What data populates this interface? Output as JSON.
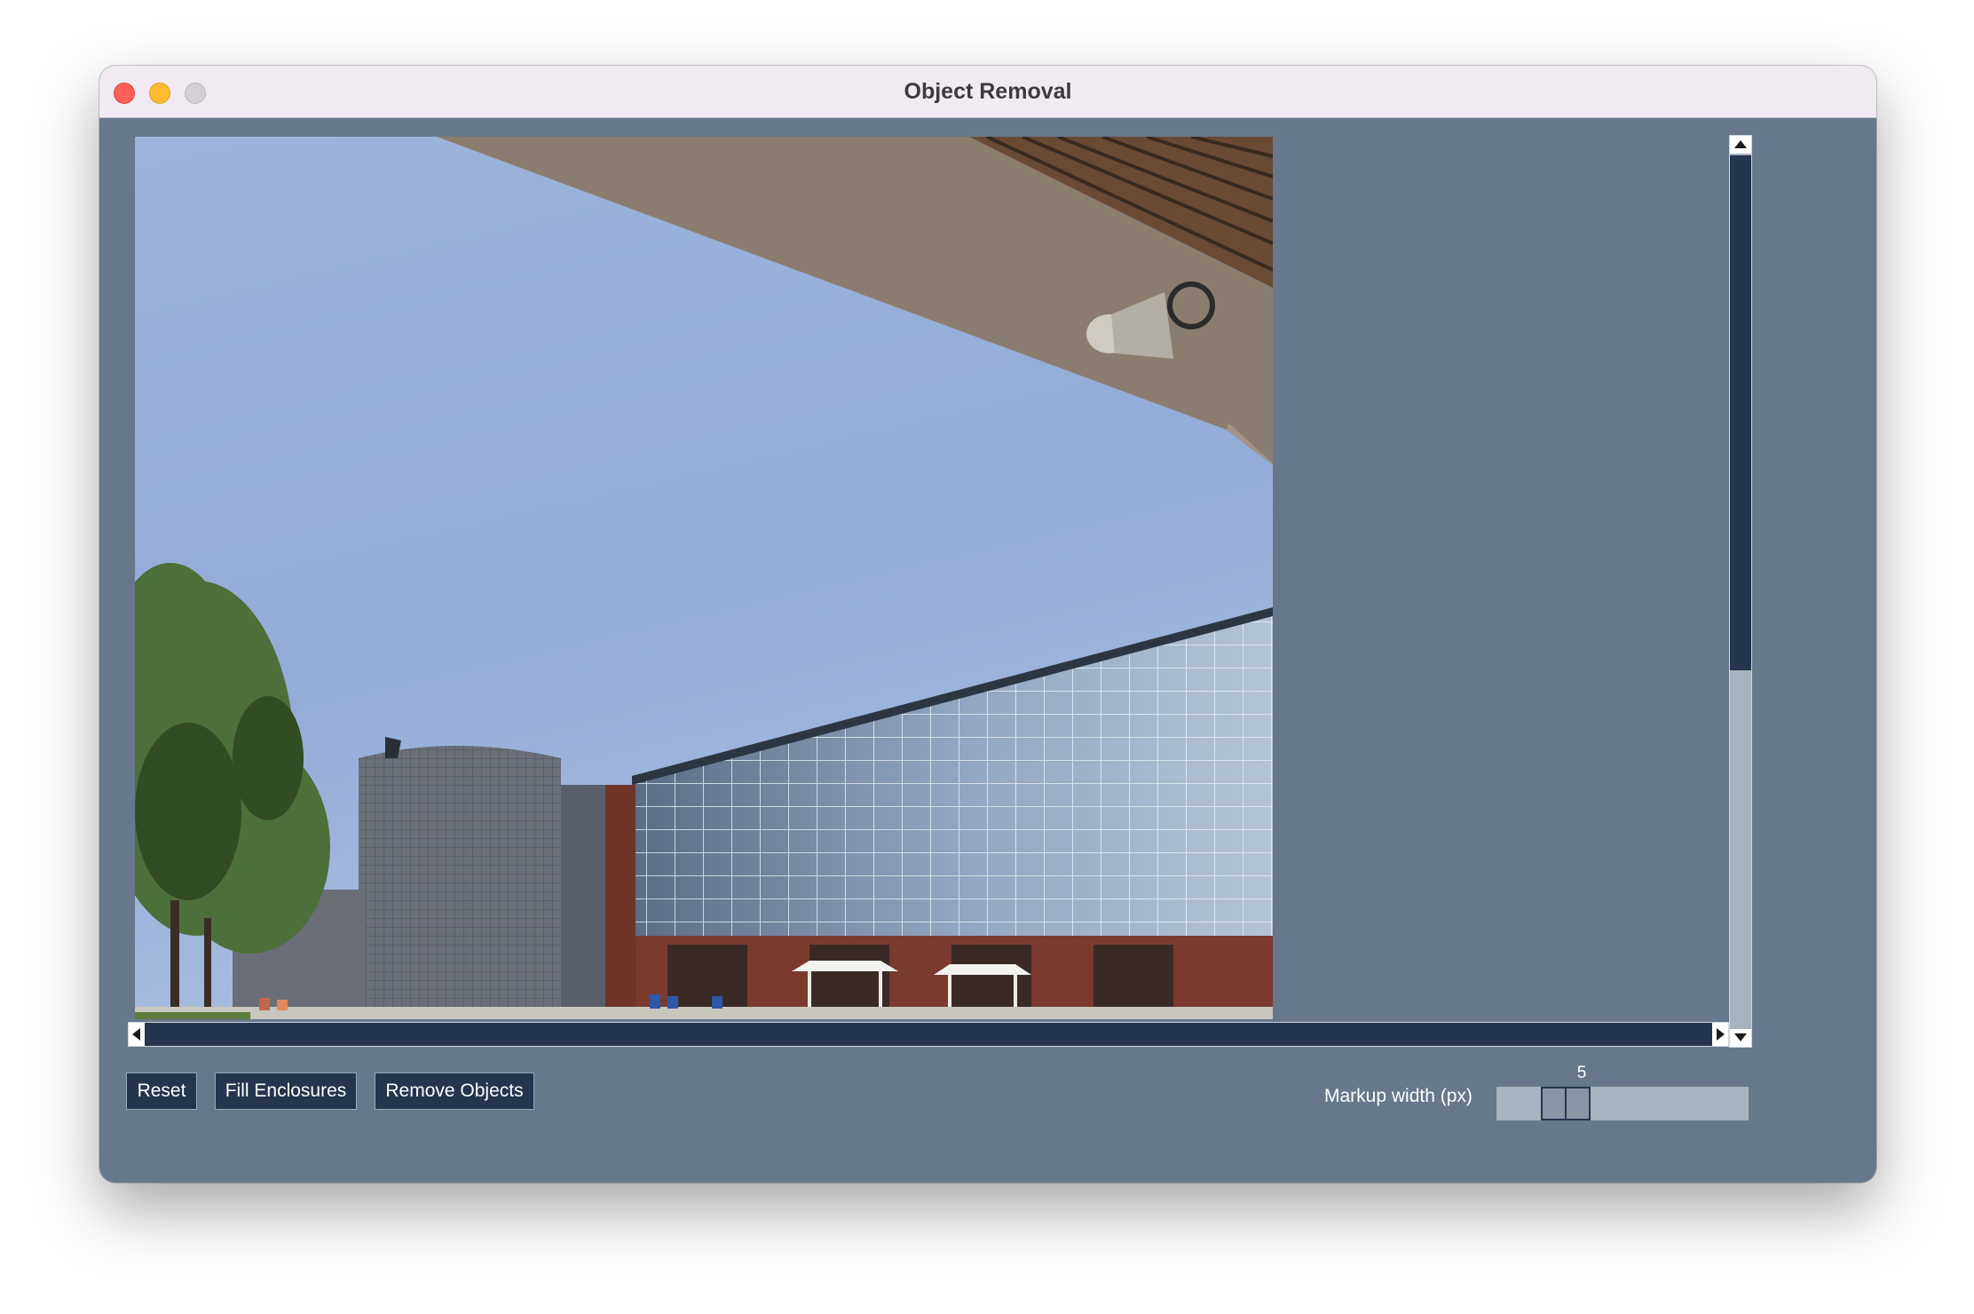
{
  "window": {
    "title": "Object Removal"
  },
  "toolbar": {
    "reset_label": "Reset",
    "fill_label": "Fill Enclosures",
    "remove_label": "Remove Objects"
  },
  "markup": {
    "label": "Markup width (px)",
    "value": "5"
  },
  "colors": {
    "window_bg": "#67788c",
    "titlebar_bg": "#f1eaf2",
    "button_bg": "#25344f",
    "scroll_thumb": "#25344f",
    "scroll_track": "#a8b3bf"
  },
  "image": {
    "description_icon": "photo-canvas"
  }
}
